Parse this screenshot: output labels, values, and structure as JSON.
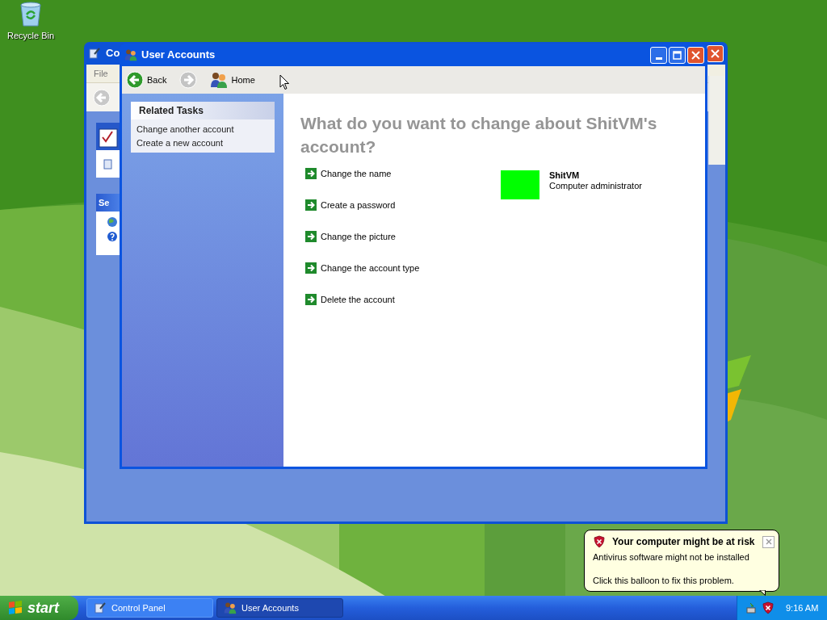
{
  "desktop_icons": [
    {
      "label": "Recycle Bin"
    }
  ],
  "control_panel": {
    "title": "Co",
    "menu": [
      "File"
    ],
    "section_heading": "Se"
  },
  "user_accounts": {
    "title": "User Accounts",
    "toolbar": [
      {
        "kind": "back",
        "label": "Back",
        "disabled": false
      },
      {
        "kind": "forward",
        "disabled": true
      },
      {
        "kind": "home",
        "label": "Home",
        "disabled": false
      }
    ],
    "related_tasks": {
      "title": "Related Tasks",
      "links": [
        "Change another account",
        "Create a new account"
      ]
    },
    "heading": "What do you want to change about ShitVM's account?",
    "actions": [
      "Change the name",
      "Create a password",
      "Change the picture",
      "Change the account type",
      "Delete the account"
    ],
    "account": {
      "name": "ShitVM",
      "type": "Computer administrator"
    }
  },
  "balloon": {
    "title": "Your computer might be at risk",
    "lines": [
      "Antivirus software might not be installed",
      "Click this balloon to fix this problem."
    ]
  },
  "taskbar": {
    "start": "start",
    "buttons": [
      {
        "label": "Control Panel",
        "kind": "control-panel",
        "selected": false
      },
      {
        "label": "User Accounts",
        "kind": "users",
        "selected": true
      }
    ],
    "clock": "9:16 AM"
  }
}
